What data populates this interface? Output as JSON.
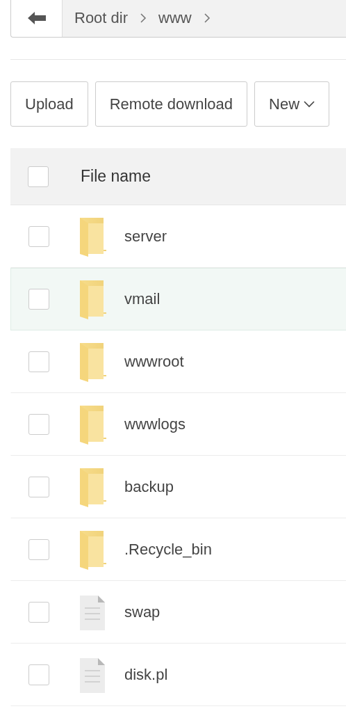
{
  "breadcrumb": {
    "items": [
      "Root dir",
      "www"
    ]
  },
  "toolbar": {
    "buttons": [
      {
        "label": "Upload",
        "kind": "plain"
      },
      {
        "label": "Remote download",
        "kind": "plain"
      },
      {
        "label": "New",
        "kind": "dropdown"
      }
    ]
  },
  "table": {
    "header": {
      "label": "File name",
      "checked": false
    },
    "rows": [
      {
        "name": "server",
        "kind": "folder",
        "checked": false,
        "highlighted": false
      },
      {
        "name": "vmail",
        "kind": "folder",
        "checked": false,
        "highlighted": true
      },
      {
        "name": "wwwroot",
        "kind": "folder",
        "checked": false,
        "highlighted": false
      },
      {
        "name": "wwwlogs",
        "kind": "folder",
        "checked": false,
        "highlighted": false
      },
      {
        "name": "backup",
        "kind": "folder",
        "checked": false,
        "highlighted": false
      },
      {
        "name": ".Recycle_bin",
        "kind": "folder",
        "checked": false,
        "highlighted": false
      },
      {
        "name": "swap",
        "kind": "file",
        "checked": false,
        "highlighted": false
      },
      {
        "name": "disk.pl",
        "kind": "file",
        "checked": false,
        "highlighted": false
      }
    ]
  }
}
